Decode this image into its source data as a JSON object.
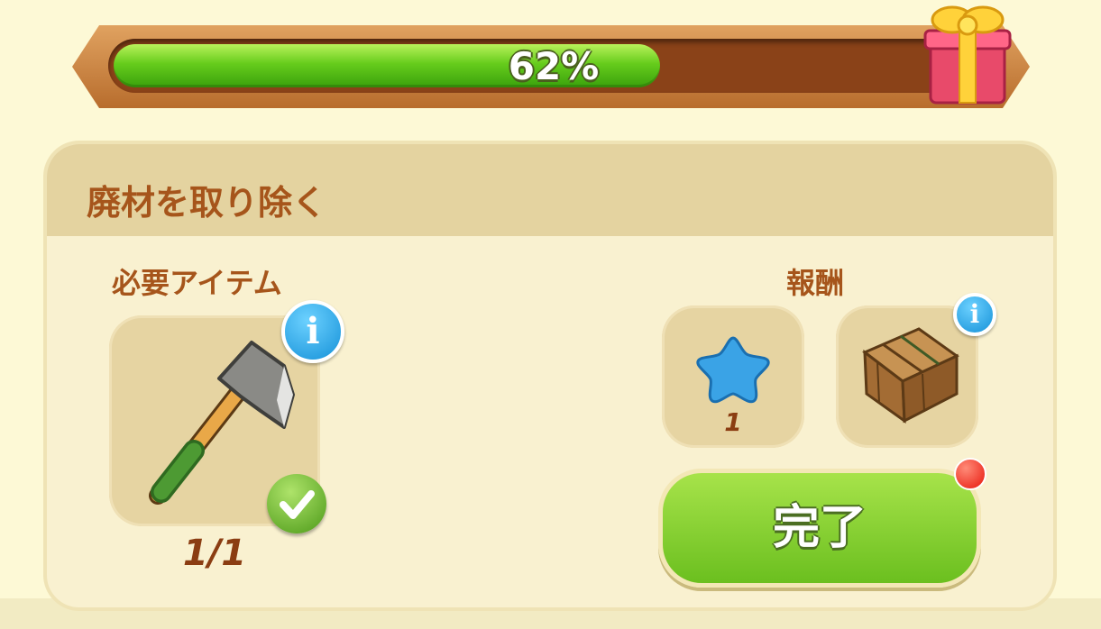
{
  "progress": {
    "percent_label": "62%",
    "fraction": 0.62
  },
  "reward_chest": {
    "icon": "gift-box-icon"
  },
  "quest": {
    "title": "廃材を取り除く",
    "required": {
      "label": "必要アイテム",
      "item_icon": "axe-icon",
      "count": "1/1",
      "status_icon": "checkmark-icon",
      "info_icon": "info-icon"
    },
    "rewards": {
      "label": "報酬",
      "items": [
        {
          "icon": "blue-star-icon",
          "amount": "1"
        },
        {
          "icon": "wooden-crate-icon",
          "info_icon": "info-icon"
        }
      ]
    },
    "complete_button": {
      "label": "完了",
      "has_notification": true
    }
  },
  "colors": {
    "progress_green": "#66cc1c",
    "title_brown": "#a6551b",
    "button_green": "#8cd13a",
    "notification_red": "#e8170d"
  }
}
